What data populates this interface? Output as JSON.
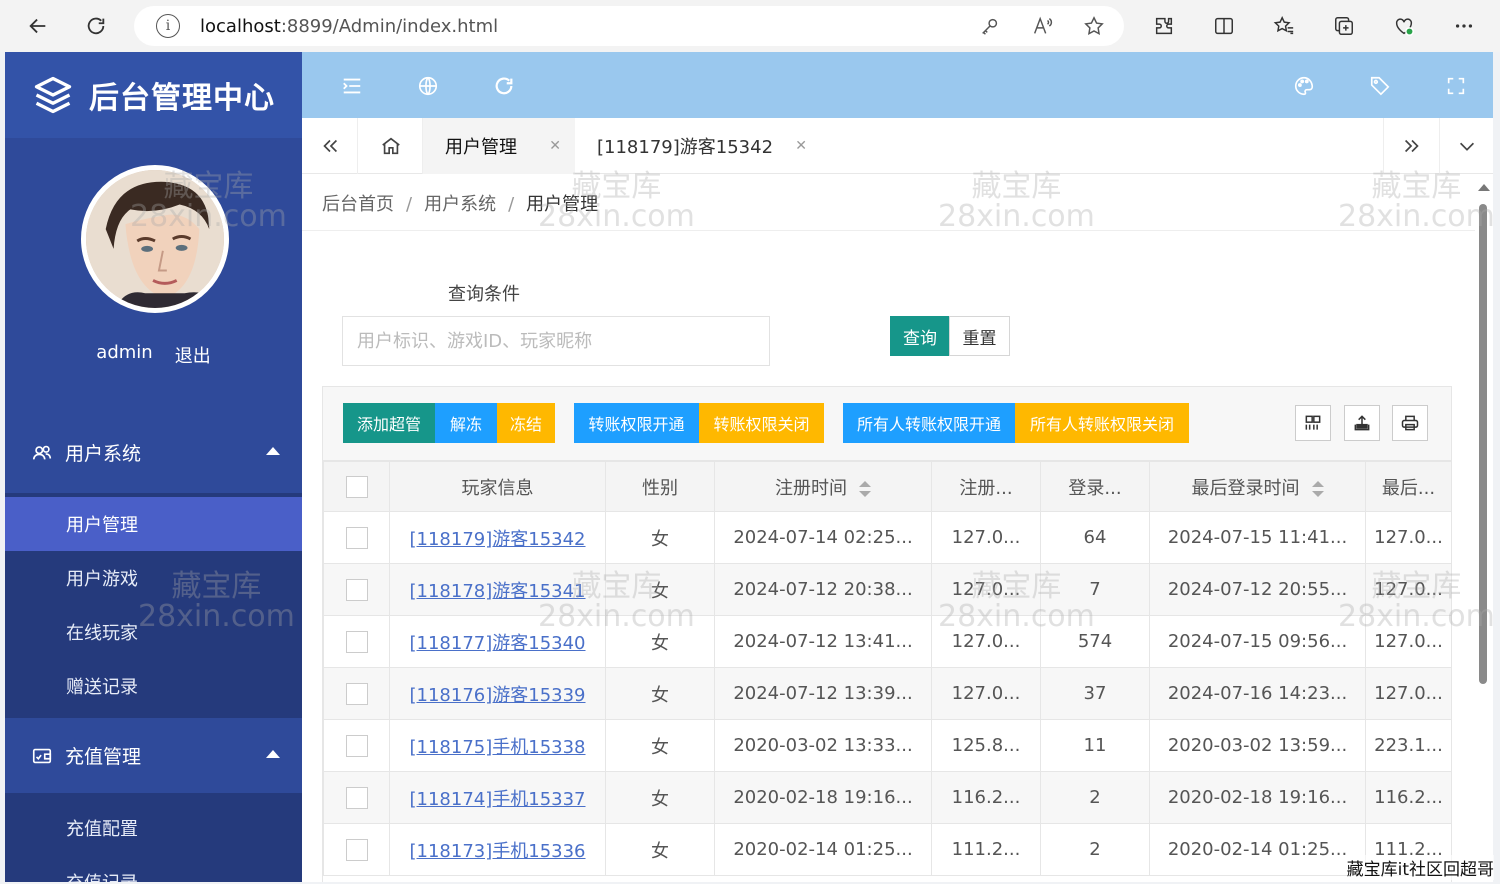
{
  "browser": {
    "url_host": "localhost",
    "url_path": ":8899/Admin/index.html"
  },
  "sidebar": {
    "title": "后台管理中心",
    "username": "admin",
    "logout": "退出",
    "groups": [
      {
        "label": "用户系统",
        "items": [
          "用户管理",
          "用户游戏",
          "在线玩家",
          "赠送记录"
        ]
      },
      {
        "label": "充值管理",
        "items": [
          "充值配置",
          "充值记录"
        ]
      }
    ]
  },
  "tabs": [
    {
      "label": "用户管理"
    },
    {
      "label": "[118179]游客15342"
    }
  ],
  "breadcrumb": {
    "home": "后台首页",
    "section": "用户系统",
    "current": "用户管理"
  },
  "query": {
    "label": "查询条件",
    "placeholder": "用户标识、游戏ID、玩家昵称",
    "search_btn": "查询",
    "reset_btn": "重置"
  },
  "toolbar": {
    "add_admin": "添加超管",
    "unfreeze": "解冻",
    "freeze": "冻结",
    "transfer_on": "转账权限开通",
    "transfer_off": "转账权限关闭",
    "all_transfer_on": "所有人转账权限开通",
    "all_transfer_off": "所有人转账权限关闭"
  },
  "colors": {
    "teal": "#16968a",
    "blue": "#1e9fff",
    "orange": "#ffb800",
    "sidebar": "#2f4a9a",
    "topbar": "#9ac8ee"
  },
  "table": {
    "headers": [
      "玩家信息",
      "性别",
      "注册时间",
      "注册...",
      "登录...",
      "最后登录时间",
      "最后..."
    ],
    "rows": [
      [
        "[118179]游客15342",
        "女",
        "2024-07-14 02:25...",
        "127.0...",
        "64",
        "2024-07-15 11:41...",
        "127.0..."
      ],
      [
        "[118178]游客15341",
        "女",
        "2024-07-12 20:38...",
        "127.0...",
        "7",
        "2024-07-12 20:55...",
        "127.0..."
      ],
      [
        "[118177]游客15340",
        "女",
        "2024-07-12 13:41...",
        "127.0...",
        "574",
        "2024-07-15 09:56...",
        "127.0..."
      ],
      [
        "[118176]游客15339",
        "女",
        "2024-07-12 13:39...",
        "127.0...",
        "37",
        "2024-07-16 14:23...",
        "127.0..."
      ],
      [
        "[118175]手机15338",
        "女",
        "2020-03-02 13:33...",
        "125.8...",
        "11",
        "2020-03-02 13:59...",
        "223.1..."
      ],
      [
        "[118174]手机15337",
        "女",
        "2020-02-18 19:16...",
        "116.2...",
        "2",
        "2020-02-18 19:16...",
        "116.2..."
      ],
      [
        "[118173]手机15336",
        "女",
        "2020-02-14 01:25...",
        "111.2...",
        "2",
        "2020-02-14 01:25...",
        "111.2..."
      ]
    ]
  },
  "watermark": {
    "line1": "藏宝库",
    "line2": "28xin.com",
    "footer": "藏宝库it社区回超哥"
  }
}
